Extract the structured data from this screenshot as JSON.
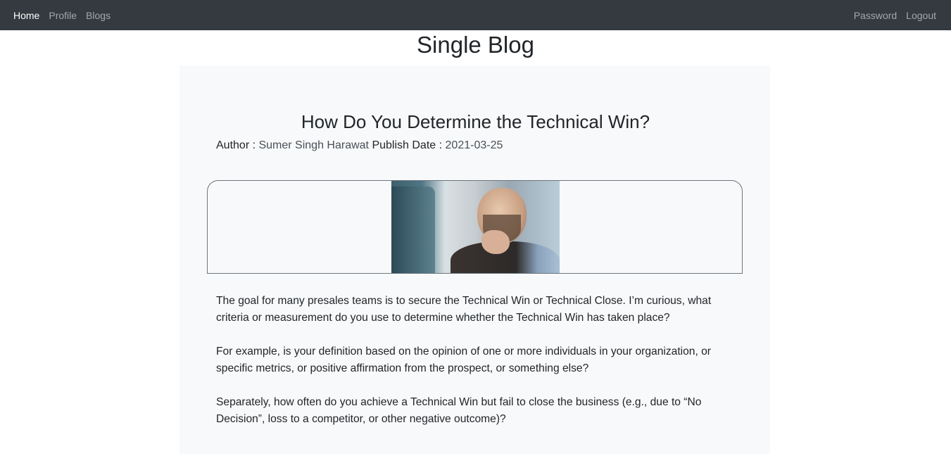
{
  "navbar": {
    "left_links": [
      {
        "label": "Home",
        "active": true
      },
      {
        "label": "Profile",
        "active": false
      },
      {
        "label": "Blogs",
        "active": false
      }
    ],
    "right_links": [
      {
        "label": "Password"
      },
      {
        "label": "Logout"
      }
    ],
    "background": "#343a40"
  },
  "page_title": "Single Blog",
  "blog": {
    "title": "How Do You Determine the Technical Win?",
    "author_label": "Author :",
    "author": "Sumer Singh Harawat",
    "date_label": "Publish Date :",
    "date": "2021-03-25",
    "paragraphs": [
      "The goal for many presales teams is to secure the Technical Win or Technical Close. I’m curious, what criteria or measurement do you use to determine whether the Technical Win has taken place?",
      "For example, is your definition based on the opinion of one or more individuals in your organization, or specific metrics, or positive affirmation from the prospect, or something else?",
      "Separately, how often do you achieve a Technical Win but fail to close the business (e.g., due to “No Decision”, loss to a competitor, or other negative outcome)?"
    ]
  },
  "colors": {
    "card_background": "#f8f9fa",
    "text": "#212529"
  }
}
